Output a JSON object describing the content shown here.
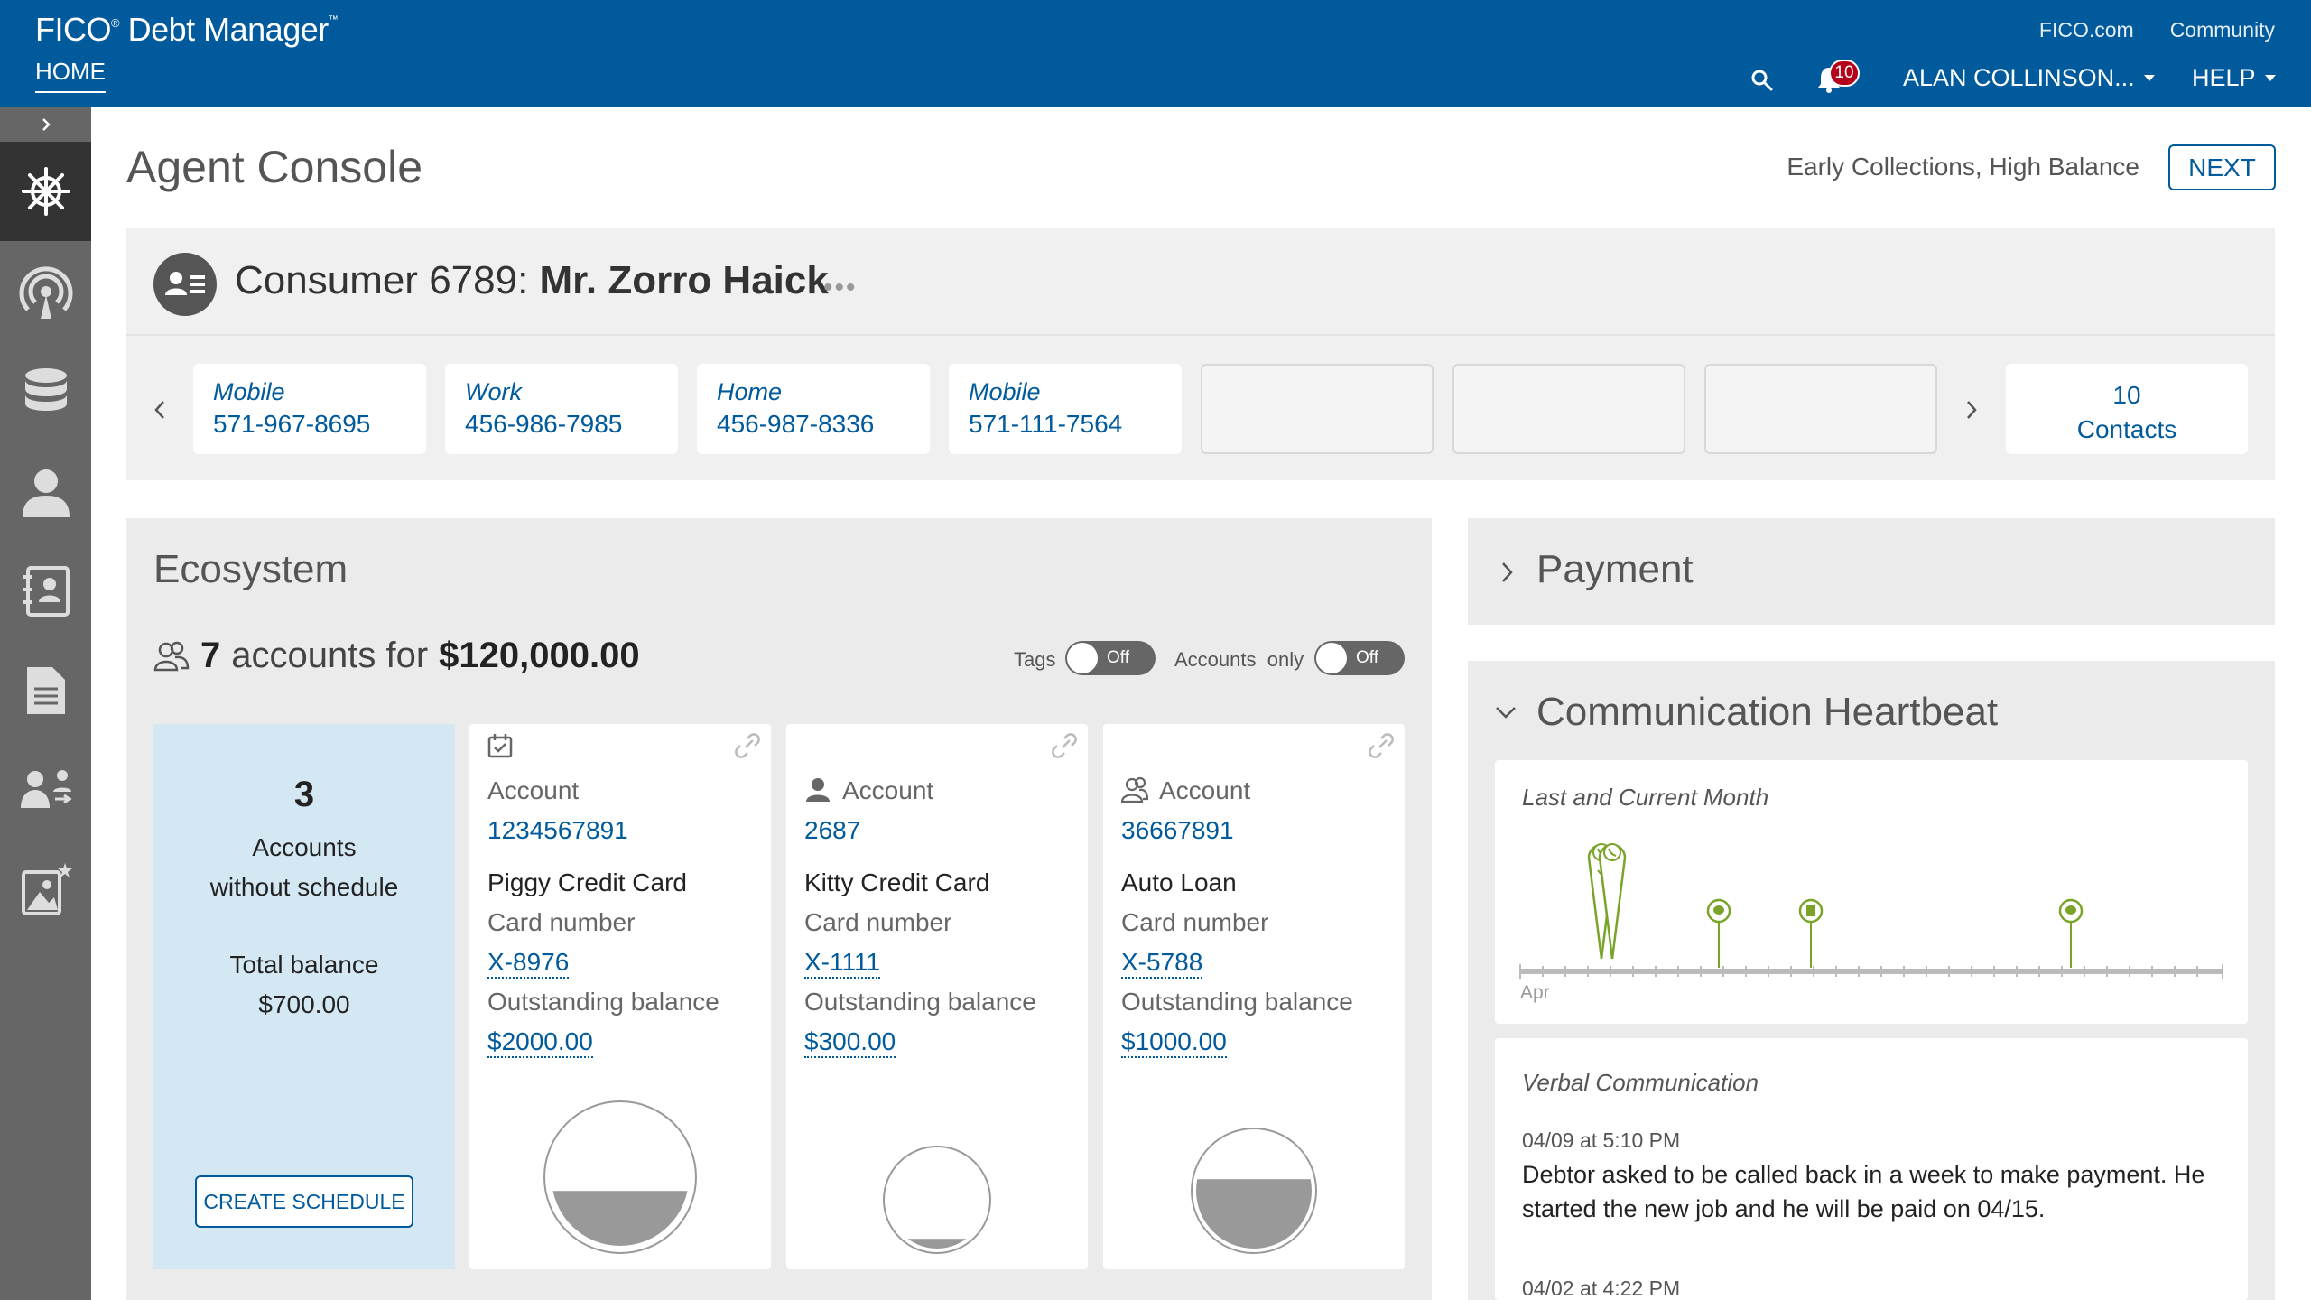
{
  "header": {
    "brand": "FICO",
    "brand_reg": "®",
    "product": "Debt Manager",
    "product_tm": "™",
    "home_tab": "HOME",
    "links": [
      "FICO.com",
      "Community"
    ],
    "notification_count": "10",
    "user_menu": "ALAN COLLINSON...",
    "help_menu": "HELP",
    "brand_color": "#005a9c"
  },
  "sidebar": {
    "items": [
      {
        "icon": "helm-wheel-icon",
        "active": true
      },
      {
        "icon": "broadcast-icon",
        "active": false
      },
      {
        "icon": "database-icon",
        "active": false
      },
      {
        "icon": "person-icon",
        "active": false
      },
      {
        "icon": "contact-book-icon",
        "active": false
      },
      {
        "icon": "document-icon",
        "active": false
      },
      {
        "icon": "transfer-users-icon",
        "active": false
      },
      {
        "icon": "image-star-icon",
        "active": false
      }
    ]
  },
  "page": {
    "title": "Agent Console",
    "queue": "Early Collections, High Balance",
    "next_label": "NEXT"
  },
  "consumer": {
    "prefix": "Consumer 6789:",
    "name": "Mr. Zorro Haick",
    "more": "•••",
    "contacts": [
      {
        "type": "Mobile",
        "number": "571-967-8695"
      },
      {
        "type": "Work",
        "number": "456-986-7985"
      },
      {
        "type": "Home",
        "number": "456-987-8336"
      },
      {
        "type": "Mobile",
        "number": "571-111-7564"
      }
    ],
    "contacts_count": "10",
    "contacts_label": "Contacts"
  },
  "ecosystem": {
    "title": "Ecosystem",
    "account_count": "7",
    "accounts_for": "accounts for",
    "total": "$120,000.00",
    "tags_label": "Tags",
    "tags_state": "Off",
    "accounts_only_label": "Accounts  only",
    "accounts_only_state": "Off",
    "no_schedule": {
      "count": "3",
      "line1": "Accounts",
      "line2": "without schedule",
      "total_label": "Total balance",
      "total_value": "$700.00",
      "button": "CREATE SCHEDULE"
    },
    "accounts": [
      {
        "label": "Account",
        "number": "1234567891",
        "name": "Piggy Credit Card",
        "card_label": "Card number",
        "card": "X-8976",
        "balance_label": "Outstanding balance",
        "balance": "$2000.00",
        "icon": "calendar-icon",
        "fill": 0.4
      },
      {
        "label": "Account",
        "number": "2687",
        "name": "Kitty Credit Card",
        "card_label": "Card number",
        "card": "X-1111",
        "balance_label": "Outstanding balance",
        "balance": "$300.00",
        "icon": "user-icon",
        "fill": 0.1
      },
      {
        "label": "Account",
        "number": "36667891",
        "name": "Auto Loan",
        "card_label": "Card number",
        "card": "X-5788",
        "balance_label": "Outstanding balance",
        "balance": "$1000.00",
        "icon": "users-icon",
        "fill": 0.6
      }
    ]
  },
  "payment": {
    "title": "Payment"
  },
  "heartbeat": {
    "title": "Communication Heartbeat",
    "chart_title": "Last and Current Month",
    "month_label": "Apr",
    "accent": "#7aa32a"
  },
  "verbal": {
    "title": "Verbal Communication",
    "entries": [
      {
        "date": "04/09 at 5:10 PM",
        "text": "Debtor asked to be called back in a week to make payment. He started the new job and he will be paid on 04/15."
      },
      {
        "date": "04/02 at 4:22 PM",
        "text": ""
      }
    ]
  }
}
